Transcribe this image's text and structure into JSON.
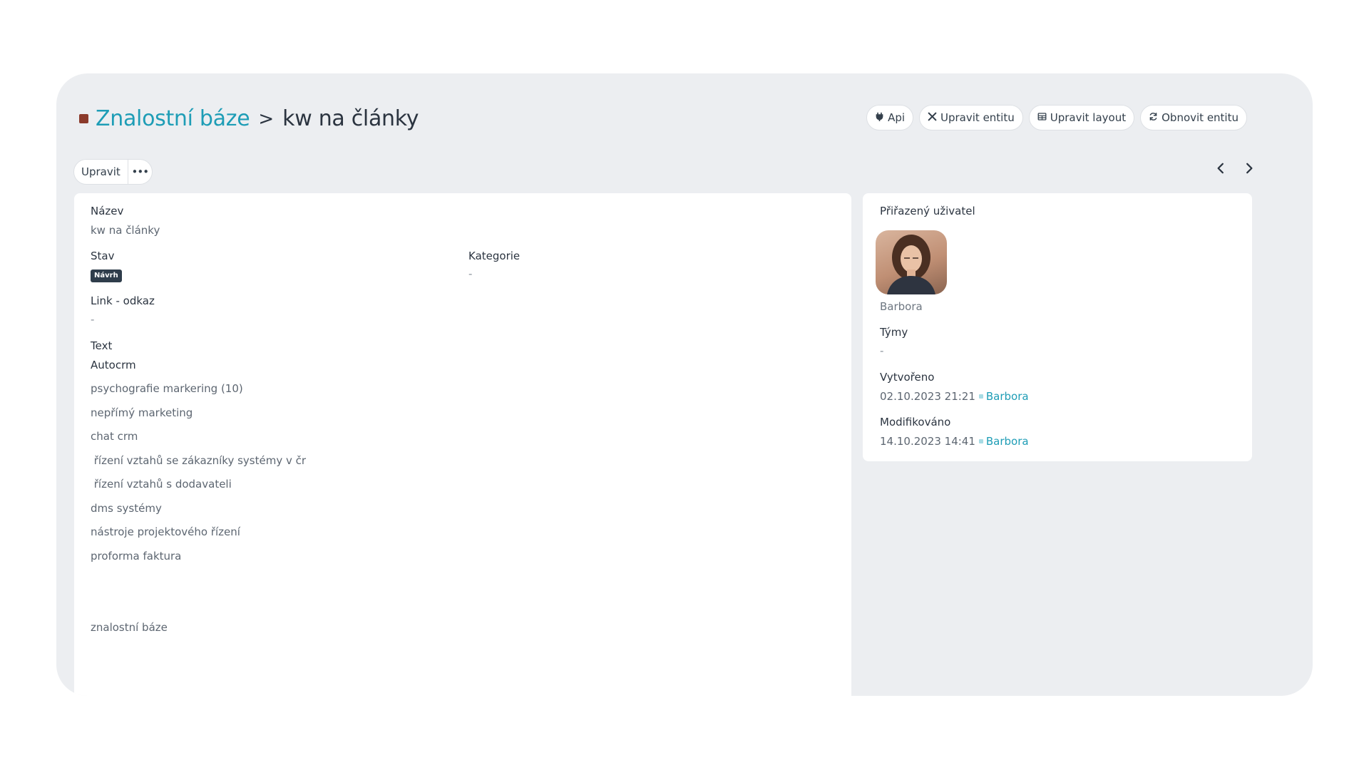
{
  "breadcrumb": {
    "parent": "Znalostní báze",
    "separator": ">",
    "current": "kw na články"
  },
  "toolbar": {
    "api": "Api",
    "edit_entity": "Upravit entitu",
    "edit_layout": "Upravit layout",
    "refresh_entity": "Obnovit entitu"
  },
  "record_actions": {
    "edit": "Upravit",
    "more": "•••"
  },
  "fields": {
    "name_label": "Název",
    "name_value": "kw na články",
    "status_label": "Stav",
    "status_value": "Návrh",
    "category_label": "Kategorie",
    "category_value": "-",
    "link_label": "Link - odkaz",
    "link_value": "-",
    "text_label": "Text",
    "text_lines": [
      "Autocrm",
      "psychografie markering (10)",
      "nepřímý marketing",
      "chat crm",
      " řízení vztahů se zákazníky systémy v čr",
      " řízení vztahů s dodavateli",
      "dms systémy",
      "nástroje projektového řízení",
      "proforma faktura",
      "znalostní báze"
    ]
  },
  "side": {
    "assigned_label": "Přiřazený uživatel",
    "assigned_user": "Barbora",
    "teams_label": "Týmy",
    "teams_value": "-",
    "created_label": "Vytvořeno",
    "created_date": "02.10.2023 21:21",
    "created_by": "Barbora",
    "modified_label": "Modifikováno",
    "modified_date": "14.10.2023 14:41",
    "modified_by": "Barbora"
  },
  "colors": {
    "accent": "#1e9db6",
    "status_badge": "#2f3d4b",
    "title_square": "#8b3a2b"
  }
}
